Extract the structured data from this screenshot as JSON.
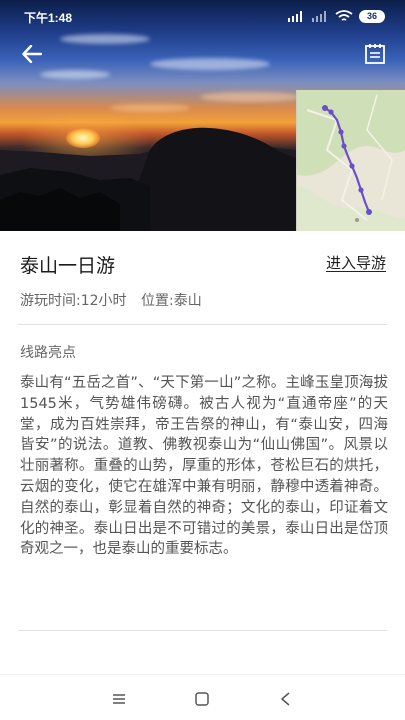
{
  "status_bar": {
    "time": "下午1:48",
    "battery_level": "36"
  },
  "header": {
    "back_icon": "arrow-left-icon",
    "notes_icon": "notebook-icon"
  },
  "route": {
    "title": "泰山一日游",
    "navigate_label": "进入导游",
    "duration": "游玩时间:12小时",
    "location": "位置:泰山"
  },
  "highlights": {
    "section_title": "线路亮点",
    "description": "泰山有“五岳之首”、“天下第一山”之称。主峰玉皇顶海拔1545米，气势雄伟磅礴。被古人视为“直通帝座”的天堂，成为百姓崇拜，帝王告祭的神山，有“泰山安，四海皆安”的说法。道教、佛教视泰山为“仙山佛国”。风景以壮丽著称。重叠的山势，厚重的形体，苍松巨石的烘托，云烟的变化，使它在雄浑中兼有明丽，静穆中透着神奇。自然的泰山，彰显着自然的神奇；文化的泰山，印证着文化的神圣。泰山日出是不可错过的美景，泰山日出是岱顶奇观之一，也是泰山的重要标志。"
  },
  "colors": {
    "route_line": "#6b4fc8",
    "status_text": "#ffffff"
  },
  "navbar": {
    "menu_icon": "menu-icon",
    "home_icon": "square-home-icon",
    "back_icon": "triangle-back-icon"
  }
}
